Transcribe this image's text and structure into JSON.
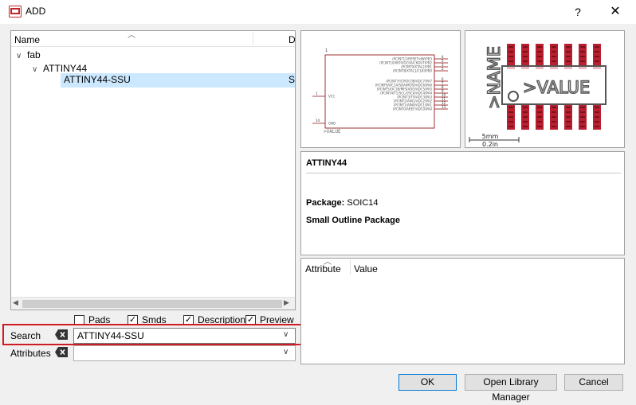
{
  "window": {
    "title": "ADD",
    "help_glyph": "?",
    "close_glyph": "✕",
    "icon": "eagle-app-icon"
  },
  "tree": {
    "columns": [
      "Name",
      "D"
    ],
    "items": [
      {
        "label": "fab",
        "level": 0,
        "expanded": true
      },
      {
        "label": "ATTINY44",
        "level": 1,
        "expanded": true
      },
      {
        "label": "ATTINY44-SSU",
        "level": 2,
        "selected": true,
        "desc_fragment": "S("
      }
    ]
  },
  "filters": {
    "pads": {
      "label": "Pads",
      "checked": false
    },
    "smds": {
      "label": "Smds",
      "checked": true
    },
    "description": {
      "label": "Description",
      "checked": true
    },
    "preview": {
      "label": "Preview",
      "checked": true
    }
  },
  "search": {
    "label": "Search",
    "value": "ATTINY44-SSU"
  },
  "attributes_filter": {
    "label": "Attributes",
    "value": ""
  },
  "symbol": {
    "pins_right": [
      {
        "num": "4",
        "name": "(PCINT11/RESET/dW)PB3"
      },
      {
        "num": "5",
        "name": "(PCINT10/INT0/OC0A/CKOUT)PB2"
      },
      {
        "num": "3",
        "name": "(PCINT9/XTAL2)PB1"
      },
      {
        "num": "2",
        "name": "(PCINT8/XTAL1/CLKI)PB0"
      },
      {
        "num": "6",
        "name": "(PCINT7/ICP/OC0B/ADC7)PA7"
      },
      {
        "num": "7",
        "name": "(PCINT6/OC1A/SDA/MOSI/ADC6)PA6"
      },
      {
        "num": "8",
        "name": "(PCINT5/OC1B/MISO/DO/ADC5)PA5"
      },
      {
        "num": "9",
        "name": "(PCINT4/T1/SCL/USCK/ADC4)PA4"
      },
      {
        "num": "10",
        "name": "(PCINT3/T0/ADC3)PA3"
      },
      {
        "num": "11",
        "name": "(PCINT2/AIN1/ADC2)PA2"
      },
      {
        "num": "12",
        "name": "(PCINT1/AIN0/ADC1)PA1"
      },
      {
        "num": "13",
        "name": "(PCINT0/AREF/ADC0)PA0"
      }
    ],
    "pins_left": [
      {
        "num": "1",
        "name": "VCC"
      },
      {
        "num": "14",
        "name": "GND"
      }
    ],
    "value_label": ">VALUE"
  },
  "package_preview": {
    "name_label": ">NAME",
    "value_label": ">VALUE",
    "scale_mm": "5mm",
    "scale_in": "0.2in"
  },
  "description": {
    "title": "ATTINY44",
    "package_label": "Package:",
    "package_value": "SOIC14",
    "long_name": "Small Outline Package"
  },
  "attribute_table": {
    "columns": [
      "Attribute",
      "Value"
    ]
  },
  "buttons": {
    "ok": "OK",
    "library_manager": "Open Library Manager",
    "cancel": "Cancel"
  },
  "colors": {
    "selection": "#cce8ff",
    "highlight_box": "#d11b24",
    "pad_red": "#b82030",
    "symbol_line": "#8b0000"
  }
}
